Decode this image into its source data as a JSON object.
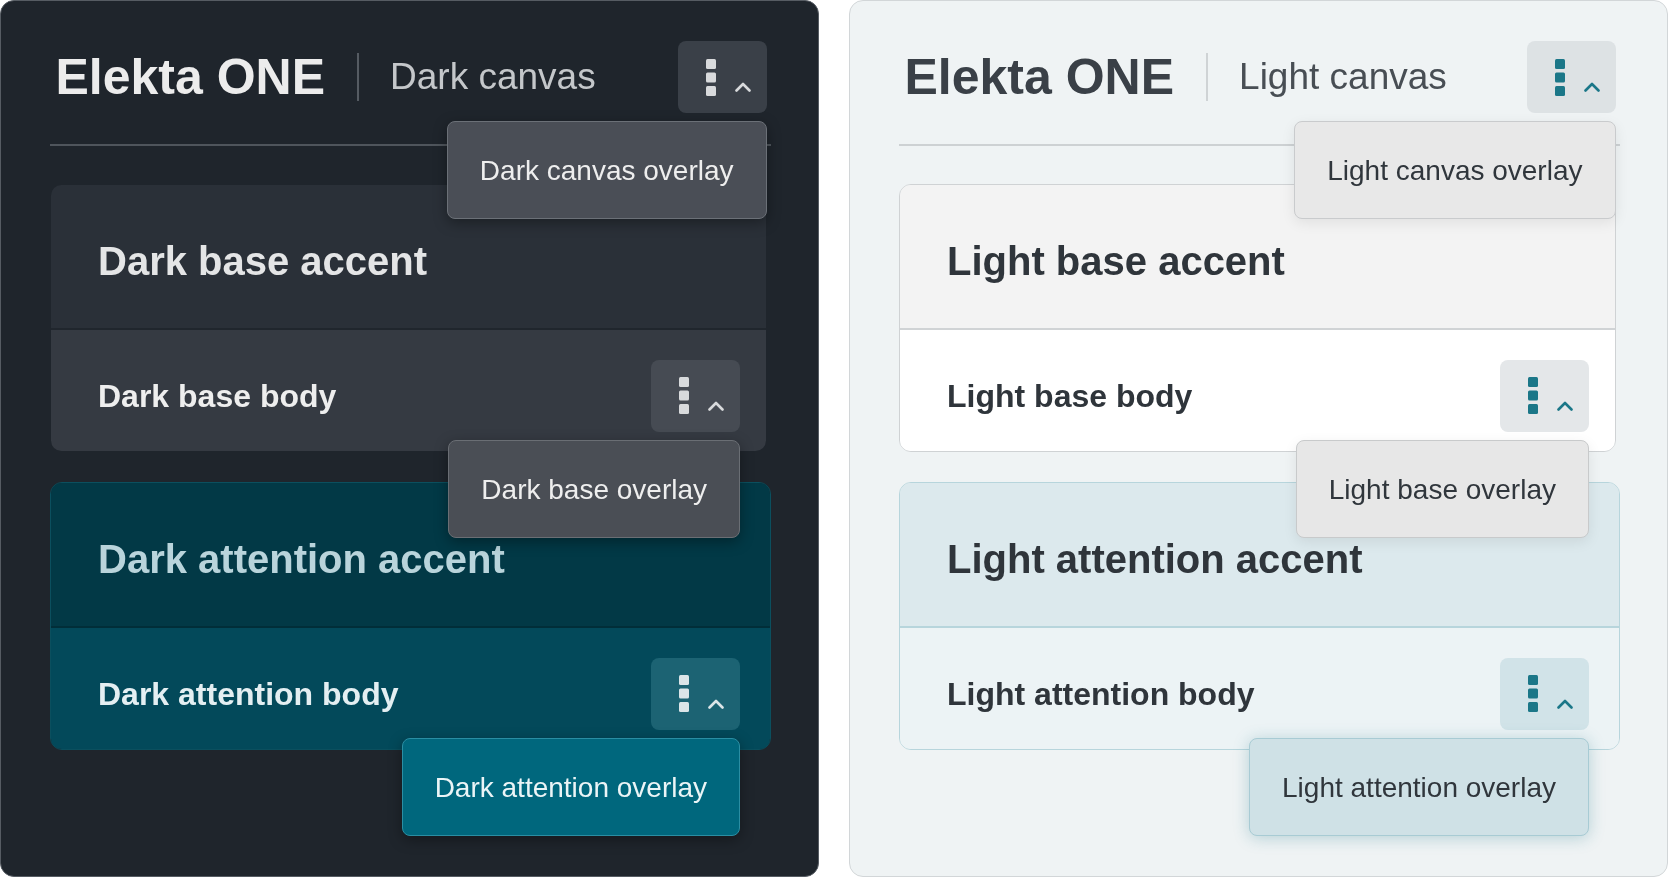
{
  "panels": [
    {
      "dark": true,
      "logo": "Elekta ONE",
      "title": "Dark canvas",
      "menu": {
        "expanded": true,
        "overlay": "Dark canvas overlay"
      },
      "cards": [
        {
          "kind": "base",
          "accent": "Dark base accent",
          "body": "Dark base body",
          "menu": {
            "expanded": true,
            "overlay": "Dark base overlay"
          }
        },
        {
          "kind": "attention",
          "accent": "Dark attention accent",
          "body": "Dark attention body",
          "menu": {
            "expanded": true,
            "overlay": "Dark attention overlay"
          }
        }
      ]
    },
    {
      "dark": false,
      "logo": "Elekta ONE",
      "title": "Light canvas",
      "menu": {
        "expanded": true,
        "overlay": "Light canvas overlay"
      },
      "cards": [
        {
          "kind": "base",
          "accent": "Light base accent",
          "body": "Light base body",
          "menu": {
            "expanded": true,
            "overlay": "Light base overlay"
          }
        },
        {
          "kind": "attention",
          "accent": "Light attention accent",
          "body": "Light attention body",
          "menu": {
            "expanded": true,
            "overlay": "Light attention overlay"
          }
        }
      ]
    }
  ]
}
